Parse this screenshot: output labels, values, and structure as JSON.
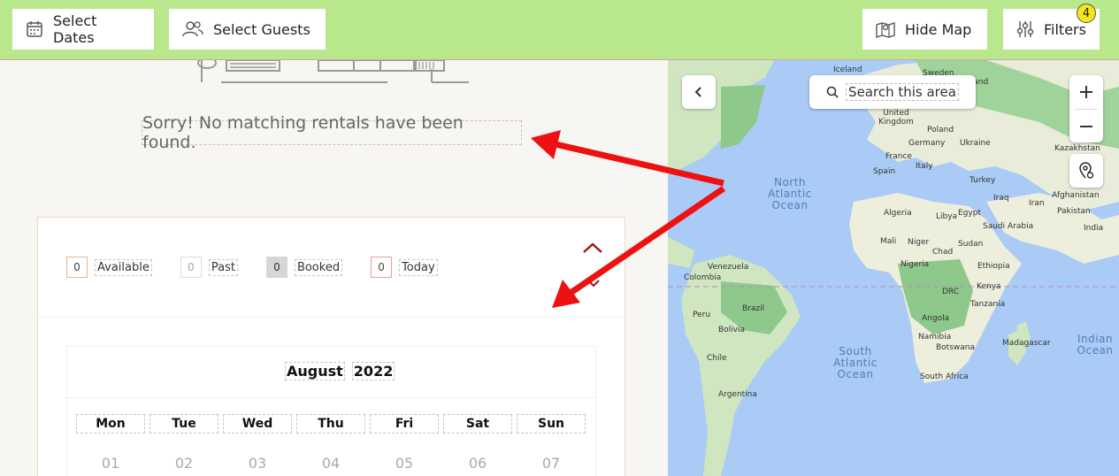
{
  "topbar": {
    "select_dates": "Select Dates",
    "select_guests": "Select Guests",
    "hide_map": "Hide Map",
    "filters": "Filters",
    "filters_count": "4"
  },
  "results": {
    "empty_message": "Sorry! No matching rentals have been found."
  },
  "legend": {
    "items": [
      {
        "count": "0",
        "label": "Available"
      },
      {
        "count": "0",
        "label": "Past"
      },
      {
        "count": "0",
        "label": "Booked"
      },
      {
        "count": "0",
        "label": "Today"
      }
    ]
  },
  "calendar": {
    "month": "August",
    "year": "2022",
    "weekdays": [
      "Mon",
      "Tue",
      "Wed",
      "Thu",
      "Fri",
      "Sat",
      "Sun"
    ],
    "first_week": [
      "01",
      "02",
      "03",
      "04",
      "05",
      "06",
      "07"
    ]
  },
  "map": {
    "search_area": "Search this area",
    "oceans": {
      "north_atlantic": "North\nAtlantic\nOcean",
      "south_atlantic": "South\nAtlantic\nOcean",
      "indian": "Indian\nOcean"
    },
    "places": [
      "Iceland",
      "Sweden",
      "Finland",
      "United Kingdom",
      "Poland",
      "Germany",
      "Ukraine",
      "France",
      "Italy",
      "Spain",
      "Turkey",
      "Kazakhstan",
      "Iran",
      "Iraq",
      "Afghanistan",
      "Pakistan",
      "India",
      "Algeria",
      "Libya",
      "Egypt",
      "Saudi Arabia",
      "Mali",
      "Niger",
      "Chad",
      "Sudan",
      "Nigeria",
      "Ethiopia",
      "Kenya",
      "DRC",
      "Tanzania",
      "Angola",
      "Namibia",
      "Botswana",
      "Madagascar",
      "South Africa",
      "Venezuela",
      "Colombia",
      "Brazil",
      "Peru",
      "Bolivia",
      "Chile",
      "Argentina"
    ]
  },
  "colors": {
    "topbar_bg": "#b9e88c",
    "badge": "#f5e61a",
    "map_water": "#a9cbf5",
    "annotation_arrow": "#ee1111"
  }
}
